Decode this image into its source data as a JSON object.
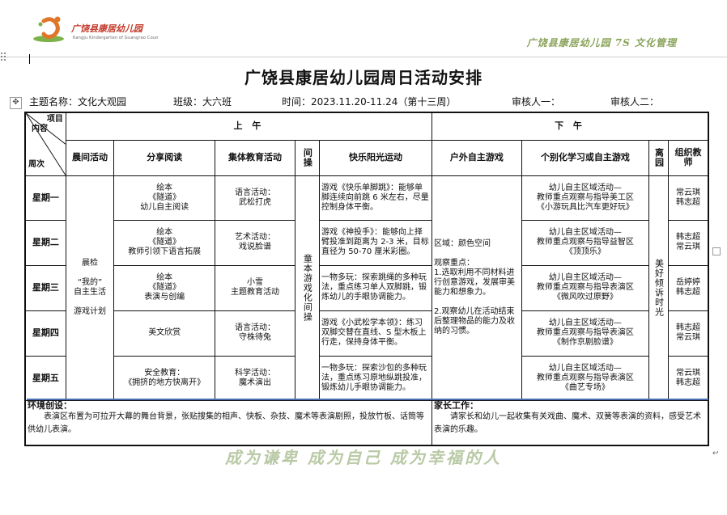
{
  "header": {
    "logo_text": "广饶县康居幼儿园",
    "logo_sub": "Kangju Kindergarten of Guangrao Coun",
    "right_text": "广饶县康居幼儿园 7S 文化管理"
  },
  "title": "广饶县康居幼儿园周日活动安排",
  "meta": {
    "theme": "主题名称：文化大观园",
    "class": "班级：大六班",
    "time": "时间：2023.11.20-11.24（第十三周）",
    "reviewer1": "审核人一：",
    "reviewer2": "审核人二："
  },
  "table": {
    "corner": {
      "item": "项目",
      "content": "内容",
      "week": "周次"
    },
    "am": "上 午",
    "pm": "下 午",
    "columns": [
      "晨间活动",
      "分享阅读",
      "集体教育活动",
      "间操",
      "快乐阳光运动",
      "户外自主游戏",
      "个别化学习或自主游戏",
      "离园",
      "组织教师"
    ],
    "morning_activity": "晨检\n\n“我的”\n自主生活\n\n游戏计划",
    "exercise": "童本游戏化间操",
    "departure": "美好倾诉时光",
    "outdoor": "区域：颜色空间\n\n观察重点：\n1.选取利用不同材料进行创意游戏，发展审美能力和想象力。\n\n2.观察幼儿在活动结束后整理物品的能力及收纳的习惯。",
    "rows": [
      {
        "day": "星期一",
        "reading": "绘本\n《隧道》\n幼儿自主阅读",
        "education": "语言活动：\n武松打虎",
        "sport": "游戏《快乐单脚跳》：能够单脚连续向前跳 6 米左右，尽量控制身体平衡。",
        "individual": "幼儿自主区域活动—\n教师重点观察与指导美工区\n《小游玩具比汽车更好玩》",
        "teacher": "常云琪\n韩志超"
      },
      {
        "day": "星期二",
        "reading": "绘本\n《隧道》\n教师引领下语言拓展",
        "education": "艺术活动：\n戏说脸谱",
        "sport": "游戏《神投手》：能够向上择臂投准到距离为 2-3 米，目标直径为 50-70 厘米彩圈。",
        "individual": "幼儿自主区域活动—\n教师重点观察与指导益智区\n《顶顶乐》",
        "teacher": "韩志超\n常云琪"
      },
      {
        "day": "星期三",
        "reading": "绘本\n《隧道》\n表演与创编",
        "education": "小雪\n主题教育活动",
        "sport": "一物多玩：探索跳绳的多种玩法，重点练习单人双脚跳，锻炼幼儿的手眼协调能力。",
        "individual": "幼儿自主区域活动—\n教师重点观察与指导表演区\n《微风吹过原野》",
        "teacher": "岳婷婷\n韩志超"
      },
      {
        "day": "星期四",
        "reading": "美文欣赏",
        "education": "语言活动：\n守株待兔",
        "sport": "游戏《小武松学本领》：练习双脚交替在直线、S 型木板上行走，保持身体平衡。",
        "individual": "幼儿自主区域活动—\n教师重点观察与指导表演区\n《制作京剧脸谱》",
        "teacher": "韩志超\n常云琪"
      },
      {
        "day": "星期五",
        "reading": "安全教育：\n《拥挤的地方快离开》",
        "education": "科学活动：\n魔术演出",
        "sport": "一物多玩：探索沙包的多种玩法，重点练习原地纵跳投准，锻炼幼儿手眼协调能力。",
        "individual": "幼儿自主区域活动—\n教师重点观察与指导表演区\n《曲艺专场》",
        "teacher": "常云琪\n韩志超"
      }
    ],
    "env_title": "环境创设：",
    "env_text": "表演区布置为可拉开大幕的舞台背景，张贴搜集的相声、快板、杂技、魔术等表演剧照，投放竹板、话筒等供幼儿表演。",
    "home_title": "家长工作：",
    "home_text": "请家长和幼儿一起收集有关戏曲、魔术、双簧等表演的资料，感受艺术表演的乐趣。"
  },
  "slogan": "成为谦卑  成为自己  成为幸福的人",
  "colors": {
    "accent_green": "#8aa35a",
    "logo_red": "#c23a2a",
    "divider_blue": "#4a6fb0"
  }
}
